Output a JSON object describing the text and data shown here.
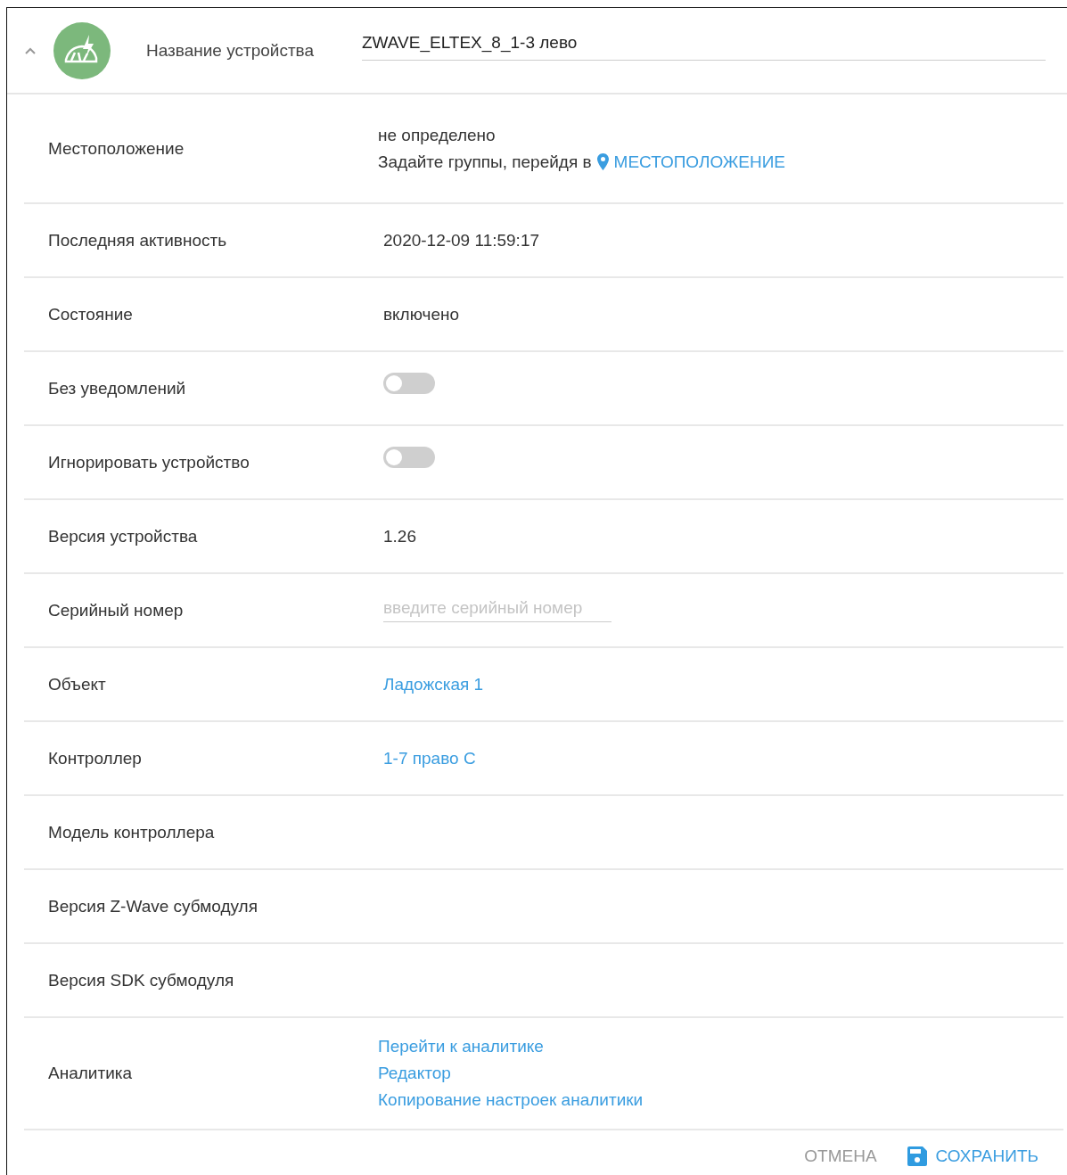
{
  "header": {
    "expanded": true,
    "label": "Название устройства",
    "value": "ZWAVE_ELTEX_8_1-3 лево"
  },
  "rows": [
    {
      "kind": "location",
      "label": "Местоположение",
      "value": "не определено",
      "hint": "Задайте группы, перейдя в",
      "link": "МЕСТОПОЛОЖЕНИЕ"
    },
    {
      "kind": "text",
      "label": "Последняя активность",
      "value": "2020-12-09 11:59:17"
    },
    {
      "kind": "text",
      "label": "Состояние",
      "value": "включено"
    },
    {
      "kind": "toggle",
      "label": "Без уведомлений",
      "on": false
    },
    {
      "kind": "toggle",
      "label": "Игнорировать устройство",
      "on": false
    },
    {
      "kind": "text",
      "label": "Версия устройства",
      "value": "1.26"
    },
    {
      "kind": "input",
      "label": "Серийный номер",
      "placeholder": "введите серийный номер"
    },
    {
      "kind": "link",
      "label": "Объект",
      "value": "Ладожская 1"
    },
    {
      "kind": "link",
      "label": "Контроллер",
      "value": "1-7 право С"
    },
    {
      "kind": "text",
      "label": "Модель контроллера"
    },
    {
      "kind": "text",
      "label": "Версия Z-Wave субмодуля"
    },
    {
      "kind": "text",
      "label": "Версия SDK субмодуля"
    },
    {
      "kind": "links",
      "label": "Аналитика",
      "links": [
        "Перейти к аналитике",
        "Редактор",
        "Копирование настроек аналитики"
      ]
    }
  ],
  "buttons": {
    "cancel": "ОТМЕНА",
    "save": "СОХРАНИТЬ"
  }
}
